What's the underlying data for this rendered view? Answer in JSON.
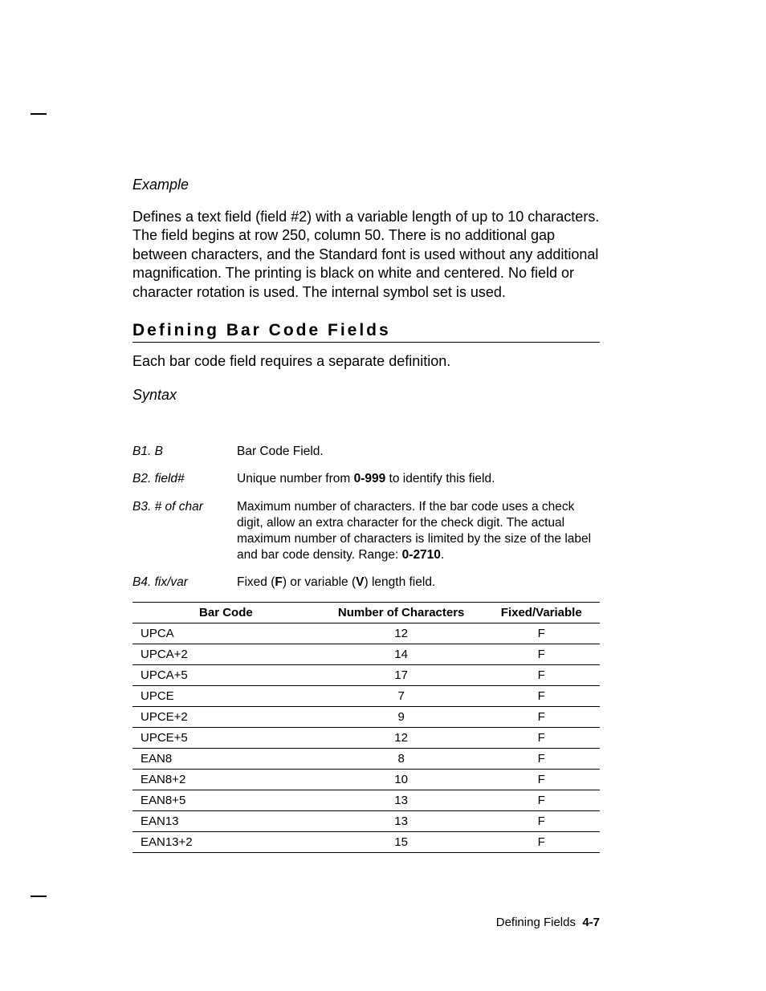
{
  "example_label": "Example",
  "example_body": "Defines a text field (field #2) with a variable length of up to 10 characters.  The field begins at row 250, column 50.  There is no additional gap between characters, and the Standard font is used without any additional magnification.  The printing is black on white and centered.  No field or character rotation is used.  The internal symbol set is used.",
  "section_heading": "Defining Bar Code Fields",
  "section_intro": "Each bar code field requires a separate definition.",
  "syntax_label": "Syntax",
  "defs": {
    "b1": {
      "term": "B1. B",
      "desc": "Bar Code Field."
    },
    "b2": {
      "term": "B2. field#",
      "desc_pre": "Unique number from ",
      "range": "0-999",
      "desc_post": " to identify this field."
    },
    "b3": {
      "term": "B3. # of char",
      "desc_pre": "Maximum number of characters.  If the bar code uses a check digit, allow an extra character for the check digit.  The actual maximum number of characters is limited by the size of the label and bar code density.  Range:  ",
      "range": "0-2710",
      "desc_post": "."
    },
    "b4": {
      "term": "B4. fix/var",
      "desc_pre": "Fixed (",
      "f": "F",
      "desc_mid": ") or variable (",
      "v": "V",
      "desc_post": ") length field."
    }
  },
  "table": {
    "headers": {
      "c1": "Bar Code",
      "c2": "Number of Characters",
      "c3": "Fixed/Variable"
    },
    "rows": [
      {
        "c1": "UPCA",
        "c2": "12",
        "c3": "F"
      },
      {
        "c1": "UPCA+2",
        "c2": "14",
        "c3": "F"
      },
      {
        "c1": "UPCA+5",
        "c2": "17",
        "c3": "F"
      },
      {
        "c1": "UPCE",
        "c2": "7",
        "c3": "F"
      },
      {
        "c1": "UPCE+2",
        "c2": "9",
        "c3": "F"
      },
      {
        "c1": "UPCE+5",
        "c2": "12",
        "c3": "F"
      },
      {
        "c1": "EAN8",
        "c2": "8",
        "c3": "F"
      },
      {
        "c1": "EAN8+2",
        "c2": "10",
        "c3": "F"
      },
      {
        "c1": "EAN8+5",
        "c2": "13",
        "c3": "F"
      },
      {
        "c1": "EAN13",
        "c2": "13",
        "c3": "F"
      },
      {
        "c1": "EAN13+2",
        "c2": "15",
        "c3": "F"
      }
    ]
  },
  "footer": {
    "title": "Defining Fields",
    "page": "4-7"
  }
}
